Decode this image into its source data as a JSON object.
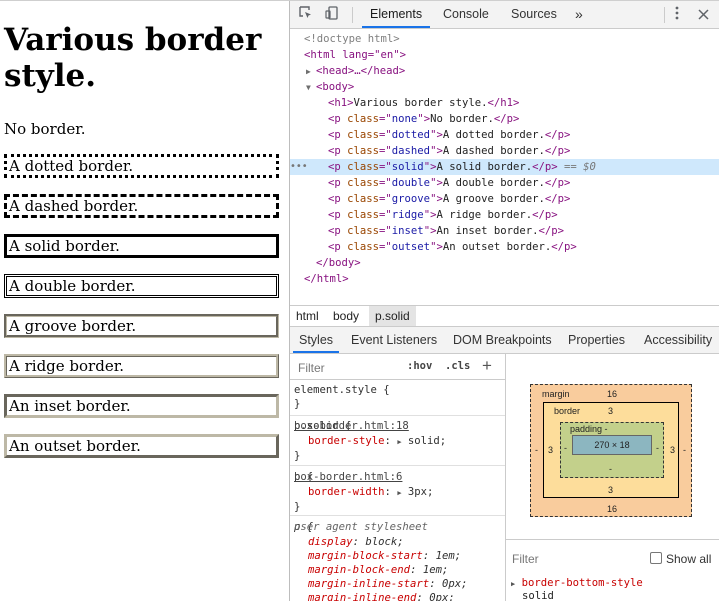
{
  "demo": {
    "heading": "Various border style.",
    "paragraphs": [
      {
        "cls": "none",
        "text": "No border."
      },
      {
        "cls": "dotted",
        "text": "A dotted border."
      },
      {
        "cls": "dashed",
        "text": "A dashed border."
      },
      {
        "cls": "solid",
        "text": "A solid border."
      },
      {
        "cls": "double",
        "text": "A double border."
      },
      {
        "cls": "groove",
        "text": "A groove border."
      },
      {
        "cls": "ridge",
        "text": "A ridge border."
      },
      {
        "cls": "inset",
        "text": "An inset border."
      },
      {
        "cls": "outset",
        "text": "An outset border."
      }
    ]
  },
  "devtools": {
    "tabs": {
      "elements": "Elements",
      "console": "Console",
      "sources": "Sources",
      "more": "»"
    },
    "icons": [
      "inspect-icon",
      "device-toggle-icon",
      "more-tabs-icon",
      "kebab-menu-icon",
      "close-icon"
    ],
    "tree": {
      "doctype": "<!doctype html>",
      "html_open": "<html lang=\"en\">",
      "head": "<head>…</head>",
      "body_open": "<body>",
      "h1_text": "Various border style.",
      "selected_suffix": "== $0",
      "body_close": "</body>",
      "html_close": "</html>",
      "dots": "•••"
    },
    "breadcrumbs": [
      "html",
      "body",
      "p.solid"
    ],
    "subtabs": [
      "Styles",
      "Event Listeners",
      "DOM Breakpoints",
      "Properties",
      "Accessibility"
    ],
    "styles": {
      "filter_placeholder": "Filter",
      "hov": ":hov",
      "cls": ".cls",
      "plus": "+",
      "element_style": "element.style {",
      "close_brace": "}",
      "rule_solid": {
        "selector": "p.solid {",
        "source": "box-border.html:18",
        "prop": "border-style",
        "value": "solid;"
      },
      "rule_p": {
        "selector": "p {",
        "source": "box-border.html:6",
        "prop": "border-width",
        "value": "3px;"
      },
      "ua_rule": {
        "selector": "p {",
        "source": "user agent stylesheet",
        "decls": [
          {
            "prop": "display",
            "value": "block;"
          },
          {
            "prop": "margin-block-start",
            "value": "1em;"
          },
          {
            "prop": "margin-block-end",
            "value": "1em;"
          },
          {
            "prop": "margin-inline-start",
            "value": "0px;"
          },
          {
            "prop": "margin-inline-end",
            "value": "0px;"
          }
        ]
      }
    },
    "boxmodel": {
      "margin_label": "margin",
      "margin_top": "16",
      "margin_bottom": "16",
      "margin_left": "-",
      "margin_right": "-",
      "border_label": "border",
      "border_top": "3",
      "border_bottom": "3",
      "border_left": "3",
      "border_right": "3",
      "padding_label": "padding -",
      "padding_bottom": "-",
      "padding_left": "-",
      "padding_right": "-",
      "content": "270 × 18"
    },
    "computed": {
      "filter_placeholder": "Filter",
      "show_all": "Show all",
      "prop": "border-bottom-style",
      "value": "solid"
    }
  }
}
